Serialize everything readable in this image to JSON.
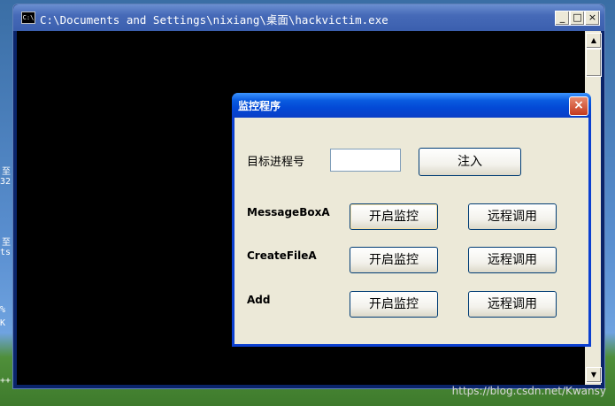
{
  "desktop": {
    "fragments": [
      "至",
      "32",
      "至",
      "ts",
      "%",
      "K",
      "++"
    ]
  },
  "console": {
    "title": "C:\\Documents and Settings\\nixiang\\桌面\\hackvictim.exe",
    "sys_icon": "C:\\",
    "minimize": "_",
    "maximize": "□",
    "close": "×",
    "scroll_up": "▲",
    "scroll_down": "▼"
  },
  "dialog": {
    "title": "监控程序",
    "close": "×",
    "pid_label": "目标进程号",
    "pid_value": "",
    "inject_button": "注入",
    "rows": [
      {
        "name": "MessageBoxA",
        "monitor": "开启监控",
        "remote": "远程调用"
      },
      {
        "name": "CreateFileA",
        "monitor": "开启监控",
        "remote": "远程调用"
      },
      {
        "name": "Add",
        "monitor": "开启监控",
        "remote": "远程调用"
      }
    ]
  },
  "watermark": "https://blog.csdn.net/Kwansy"
}
